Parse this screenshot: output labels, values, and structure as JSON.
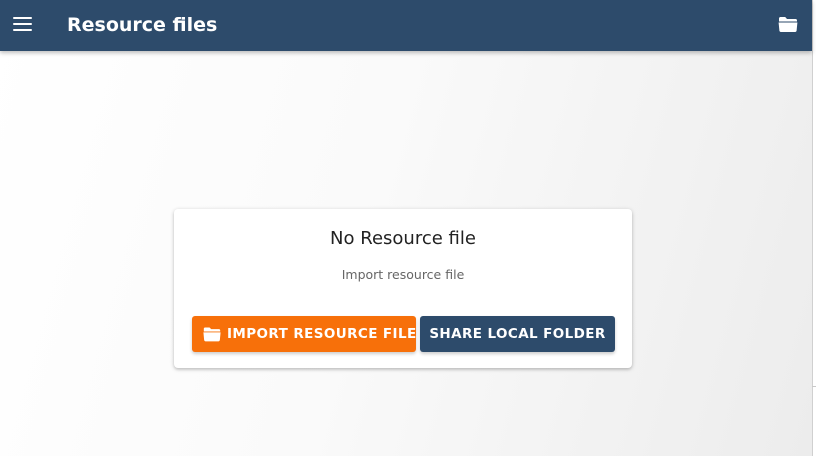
{
  "app_bar": {
    "title": "Resource files",
    "menu_icon": "menu-icon",
    "folder_icon": "folder-icon",
    "background_color": "#2d4b6b"
  },
  "empty_state": {
    "title": "No Resource file",
    "subtitle": "Import resource file",
    "buttons": {
      "import": {
        "label": "IMPORT RESOURCE FILE",
        "icon": "folder-icon",
        "color": "#f7700a"
      },
      "share": {
        "label": "SHARE LOCAL FOLDER",
        "color": "#2d4b6b"
      }
    }
  }
}
